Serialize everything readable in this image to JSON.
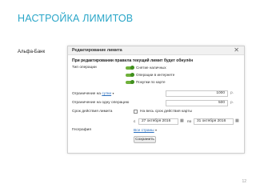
{
  "slide": {
    "title": "НАСТРОЙКА ЛИМИТОВ",
    "bank_label": "Альфа-Банк",
    "page_number": "12"
  },
  "dialog": {
    "title": "Редактирование лимита",
    "close": "✕",
    "warning": "При редактировании правила текущий лимит будет обнулён",
    "operation_type": {
      "label": "Тип операции",
      "items": [
        "Снятие наличных",
        "Операции в интернете",
        "Покупки по карте"
      ]
    },
    "limit_on": {
      "label": "Ограничение на",
      "period_link": "сутки",
      "value": "1000",
      "unit": "р."
    },
    "single_limit": {
      "label": "Ограничение на одну операцию",
      "value": "500",
      "unit": "р."
    },
    "validity": {
      "label": "Срок действия лимита",
      "checkbox_label": "На весь срок действия карты",
      "from_prefix": "с",
      "from_value": "27 октября 2016",
      "to_prefix": "по",
      "to_value": "31 октября 2016"
    },
    "geography": {
      "label": "География",
      "value": "Все страны"
    },
    "save_button": "Сохранить"
  },
  "icons": {
    "close": "close-icon",
    "calendar": "calendar-icon",
    "caret": "chevron-down-icon"
  }
}
